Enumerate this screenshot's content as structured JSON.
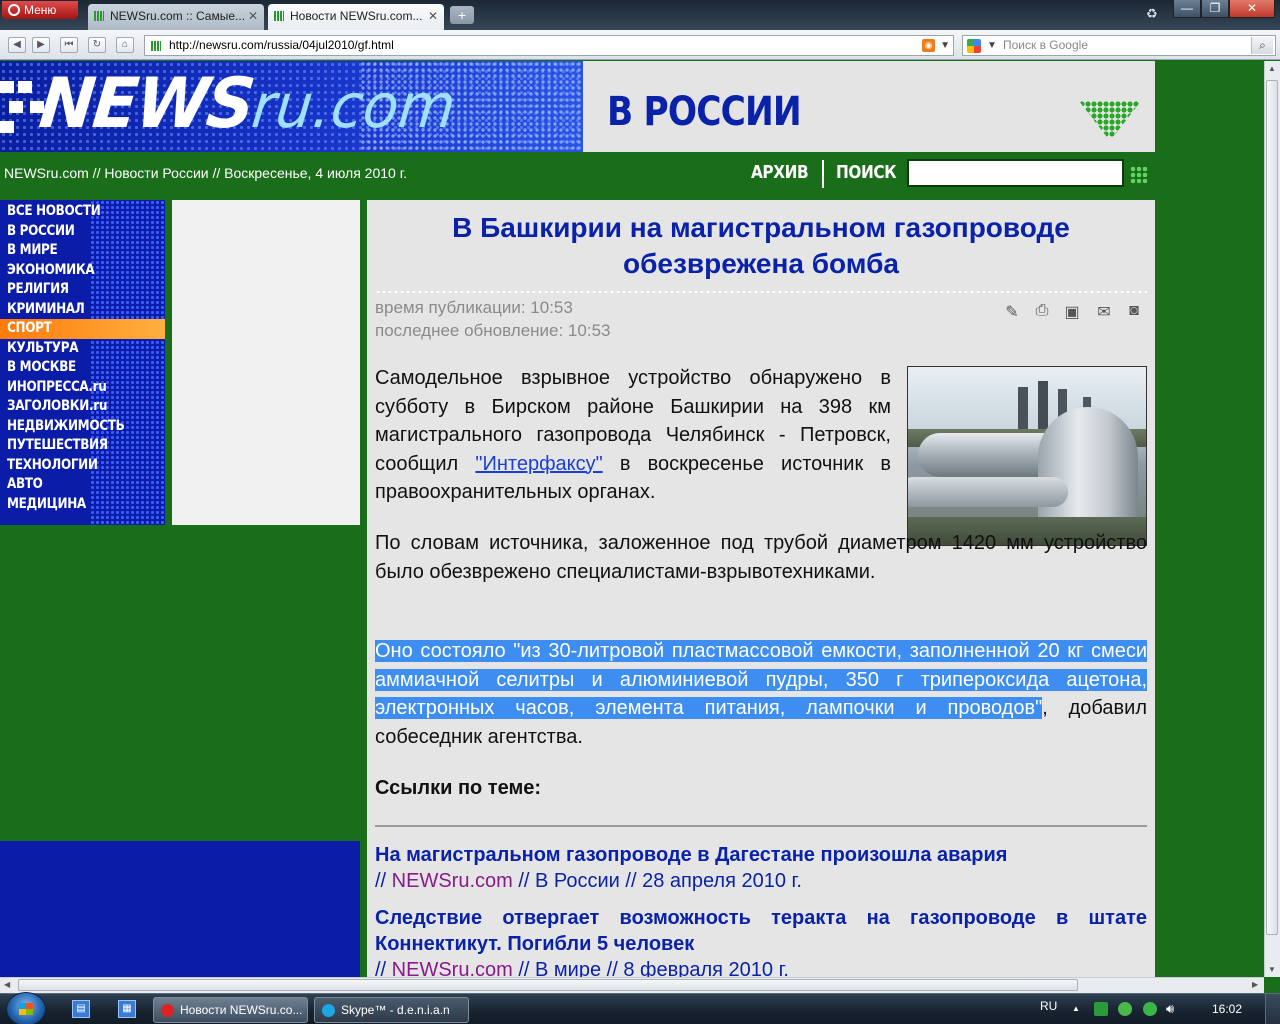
{
  "browser": {
    "menu_label": "Меню",
    "tabs": [
      {
        "label": "NEWSru.com :: Самые..."
      },
      {
        "label": "Новости NEWSru.com..."
      }
    ],
    "address": "http://newsru.com/russia/04jul2010/gf.html",
    "search_placeholder": "Поиск в Google"
  },
  "header": {
    "logo_text": "NEWS",
    "logo_suffix": "ru.com",
    "section_title": "В РОССИИ"
  },
  "crumbbar": {
    "breadcrumb": "NEWSru.com // Новости России // Воскресенье, 4 июля 2010 г.",
    "archive_label": "АРХИВ",
    "search_label": "ПОИСК",
    "search_value": ""
  },
  "sidebar": {
    "items": [
      {
        "label": "ВСЕ НОВОСТИ"
      },
      {
        "label": "В РОССИИ"
      },
      {
        "label": "В МИРЕ"
      },
      {
        "label": "ЭКОНОМИКА"
      },
      {
        "label": "РЕЛИГИЯ"
      },
      {
        "label": "КРИМИНАЛ"
      },
      {
        "label": "СПОРТ"
      },
      {
        "label": "КУЛЬТУРА"
      },
      {
        "label": "В МОСКВЕ"
      },
      {
        "label": "ИНОПРЕССА.ru"
      },
      {
        "label": "ЗАГОЛОВКИ.ru"
      },
      {
        "label": "НЕДВИЖИМОСТЬ"
      },
      {
        "label": "ПУТЕШЕСТВИЯ"
      },
      {
        "label": "ТЕХНОЛОГИИ"
      },
      {
        "label": "АВТО"
      },
      {
        "label": "МЕДИЦИНА"
      }
    ],
    "active_item": "СПОРТ"
  },
  "article": {
    "headline": "В Башкирии на магистральном газопроводе обезврежена бомба",
    "published": "время публикации: 10:53",
    "updated": "последнее обновление: 10:53",
    "tools": [
      "pencil-icon",
      "print-icon",
      "save-icon",
      "email-icon",
      "camera-icon"
    ],
    "p1_before": "Самодельное взрывное устройство обнаружено в субботу в Бирском районе Башкирии на 398 км магистрального газопровода Челябинск - Петровск, сообщил ",
    "p1_link": "\"Интерфаксу\"",
    "p1_after": " в воскресенье источник в правоохранительных органах.",
    "p2": "По словам источника, заложенное под трубой диаметром 1420 мм устройство было обезврежено специалистами-взрывотехниками.",
    "p3_selected": "Оно состояло \"из 30-литровой пластмассовой емкости, заполненной 20 кг смеси аммиачной селитры и алюминиевой пудры, 350 г трипероксида ацетона, электронных часов, элемента питания, лампочки и проводов\"",
    "p3_rest": ", добавил собеседник агентства.",
    "links_title": "Ссылки по теме:",
    "related": [
      {
        "title": "На магистральном газопроводе в Дагестане произошла авария",
        "prefix": "// ",
        "site": "NEWSru.com",
        "sep1": " // ",
        "section": "В России",
        "sep2": " // ",
        "date": "28 апреля 2010 г."
      },
      {
        "title": "Следствие отвергает возможность теракта на газопроводе в штате Коннектикут. Погибли 5 человек",
        "prefix": "// ",
        "site": "NEWSru.com",
        "sep1": " // ",
        "section": "В мире",
        "sep2": " // ",
        "date": "8 февраля 2010 г."
      }
    ]
  },
  "taskbar": {
    "tasks": [
      {
        "label": "Новости NEWSru.co..."
      },
      {
        "label": "Skype™ - d.e.n.i.a.n"
      }
    ],
    "lang": "RU",
    "time": "16:02"
  },
  "colors": {
    "site_green": "#1a6e1a",
    "site_blue": "#0a22a8",
    "nav_active": "#ff8a1a",
    "selection": "#3d8ef0"
  }
}
